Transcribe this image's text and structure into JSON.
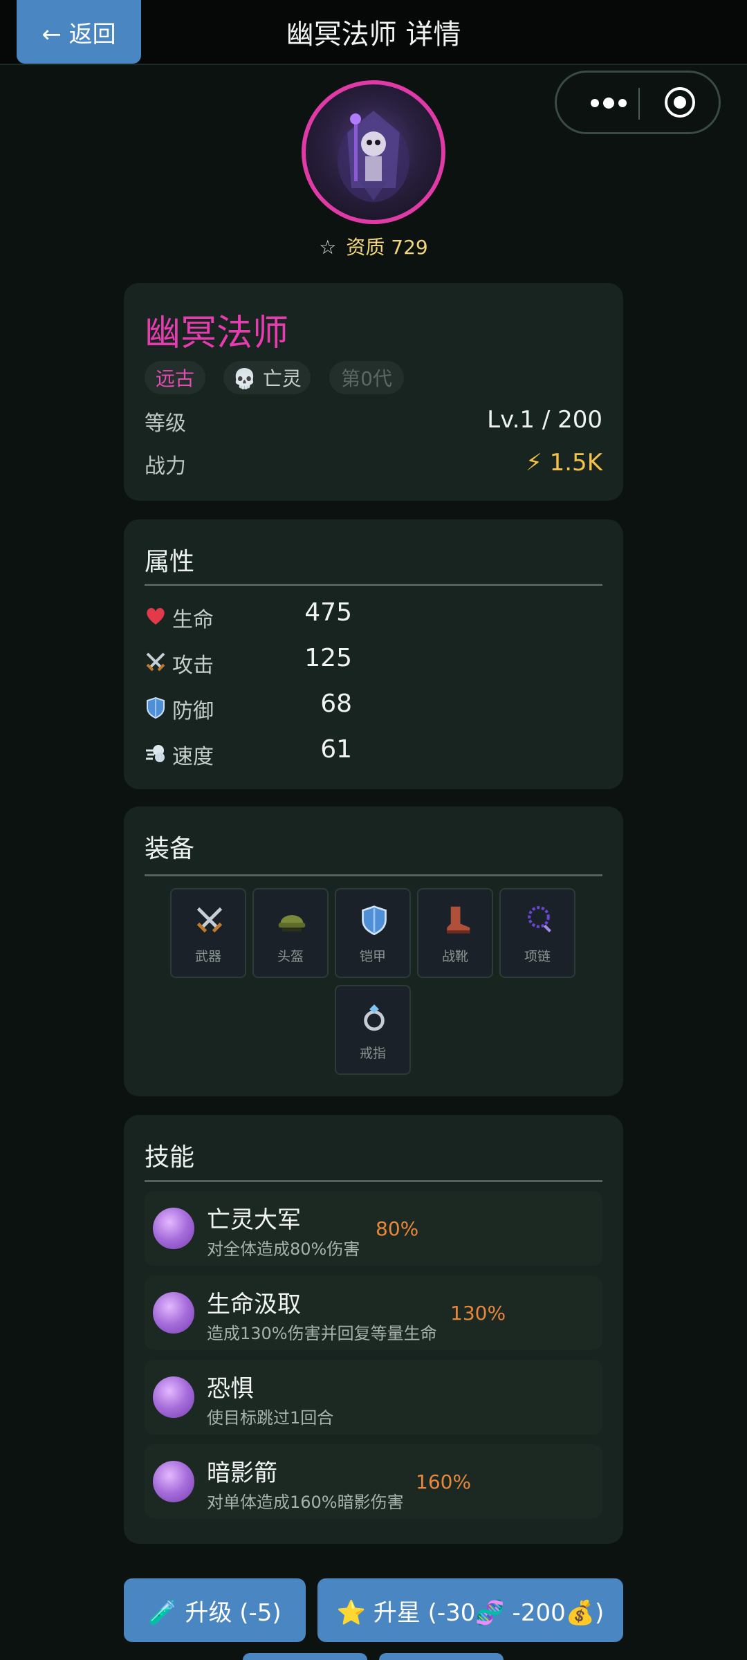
{
  "header": {
    "back_label": "← 返回",
    "title": "幽冥法师 详情"
  },
  "hero": {
    "quality_star": "☆",
    "quality": "资质 729"
  },
  "info": {
    "name": "幽冥法师",
    "tags": [
      {
        "label": "远古",
        "color": "#e84ab3"
      },
      {
        "label": "💀 亡灵",
        "color": "#c9d0cd"
      },
      {
        "label": "第0代",
        "color": "#5b6864"
      }
    ],
    "rows": [
      {
        "label": "等级",
        "value": "Lv.1 / 200"
      },
      {
        "label": "战力",
        "value": "⚡ 1.5K"
      }
    ]
  },
  "attributes": {
    "title": "属性",
    "items": [
      {
        "icon": "heart-icon",
        "label": "生命",
        "value": "475"
      },
      {
        "icon": "crossed-swords-icon",
        "label": "攻击",
        "value": "125"
      },
      {
        "icon": "shield-icon",
        "label": "防御",
        "value": "68"
      },
      {
        "icon": "wind-icon",
        "label": "速度",
        "value": "61"
      }
    ]
  },
  "equipment": {
    "title": "装备",
    "slots": [
      {
        "icon": "crossed-swords-icon",
        "label": "武器"
      },
      {
        "icon": "helmet-icon",
        "label": "头盔"
      },
      {
        "icon": "shield-icon",
        "label": "铠甲"
      },
      {
        "icon": "boot-icon",
        "label": "战靴"
      },
      {
        "icon": "necklace-icon",
        "label": "项链"
      },
      {
        "icon": "ring-icon",
        "label": "戒指"
      }
    ]
  },
  "skills": {
    "title": "技能",
    "items": [
      {
        "name": "亡灵大军",
        "desc": "对全体造成80%伤害",
        "pct": "80%"
      },
      {
        "name": "生命汲取",
        "desc": "造成130%伤害并回复等量生命",
        "pct": "130%"
      },
      {
        "name": "恐惧",
        "desc": "使目标跳过1回合",
        "pct": ""
      },
      {
        "name": "暗影箭",
        "desc": "对单体造成160%暗影伤害",
        "pct": "160%"
      }
    ]
  },
  "actions": {
    "upgrade": "🧪 升级 (-5)",
    "star_up": "⭐ 升星 (-30🧬 -200💰)"
  },
  "colors": {
    "accent": "#4a86c2",
    "rarity_pink": "#e63cb0",
    "gold": "#f2d67a",
    "percent_orange": "#e8873a"
  }
}
